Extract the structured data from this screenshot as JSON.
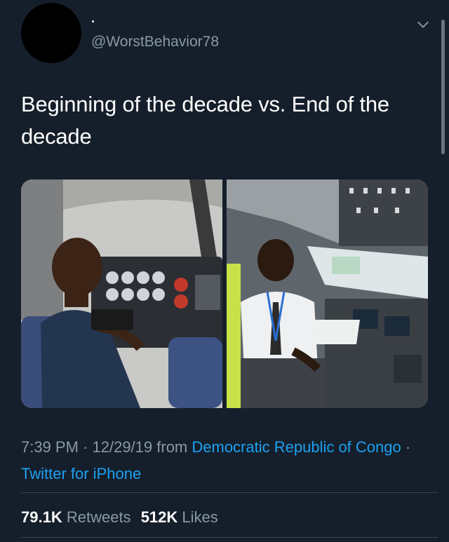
{
  "author": {
    "display_name": ".",
    "handle": "@WorstBehavior78"
  },
  "icons": {
    "avatar": "avatar-circle",
    "menu": "chevron-down-icon"
  },
  "tweet": {
    "text": "Beginning of the decade vs. End of the decade"
  },
  "meta": {
    "time": "7:39 PM",
    "sep1": " · ",
    "date": "12/29/19",
    "from": " from ",
    "location": "Democratic Republic of Congo",
    "sep2": " · ",
    "source": "Twitter for iPhone"
  },
  "stats": {
    "retweets_count": "79.1K",
    "retweets_label": "Retweets",
    "likes_count": "512K",
    "likes_label": "Likes"
  },
  "colors": {
    "background": "#151f2b",
    "secondary_text": "#8899a6",
    "link": "#1da1f2",
    "divider": "#38444d"
  }
}
